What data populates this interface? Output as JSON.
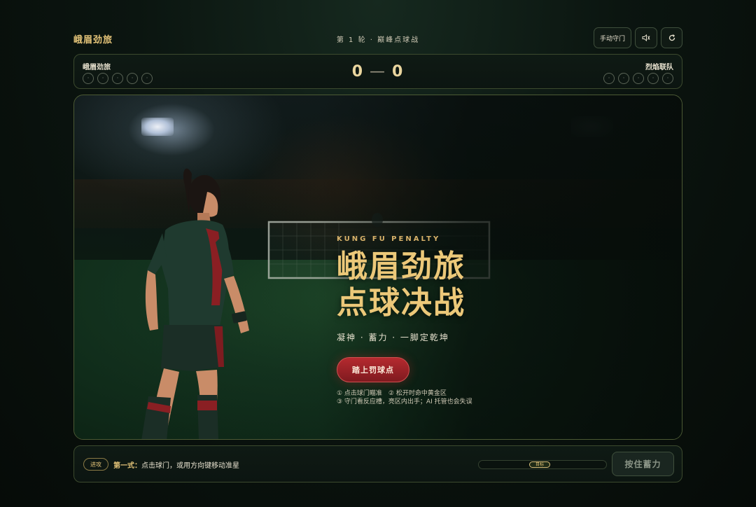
{
  "header": {
    "brand": "峨眉劲旅",
    "round": "第 1 轮 · 巅峰点球战",
    "keeper_mode_label": "手动守门",
    "sound_icon": "sound-icon",
    "reset_icon": "refresh-icon"
  },
  "scoreboard": {
    "home_team": "峨眉劲旅",
    "away_team": "烈焰联队",
    "home_score": "0",
    "away_score": "0",
    "dash": "—",
    "home_attempts": [
      "·",
      "·",
      "·",
      "·",
      "·"
    ],
    "away_attempts": [
      "·",
      "·",
      "·",
      "·",
      "·"
    ]
  },
  "hero": {
    "kicker": "KUNG FU PENALTY",
    "title_line1": "峨眉劲旅",
    "title_line2": "点球决战",
    "subtitle": "凝神 · 蓄力 · 一脚定乾坤",
    "start_button": "踏上罚球点",
    "hint_line1": "① 点击球门瞄准　② 松开时命中黄金区",
    "hint_line2": "③ 守门看反应槽，亮区内出手；AI 托管也会失误"
  },
  "bottom": {
    "phase_badge": "进攻",
    "instruction_label": "第一式：",
    "instruction_text": "点击球门，或用方向键移动准星",
    "power_marker": "目标",
    "power_level": 0,
    "charge_button": "按住蓄力"
  },
  "colors": {
    "accent_gold": "#e3c378",
    "accent_red": "#b52a2f",
    "bg_green": "#0c1511"
  }
}
